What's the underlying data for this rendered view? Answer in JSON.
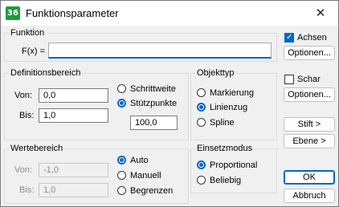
{
  "window": {
    "title": "Funktionsparameter",
    "app_icon": "36",
    "close_glyph": "✕"
  },
  "funktion": {
    "group_label": "Funktion",
    "fx_label": "F(x) =",
    "fx_value": ""
  },
  "definitionsbereich": {
    "group_label": "Definitionsbereich",
    "von_label": "Von:",
    "von_value": "0,0",
    "bis_label": "Bis:",
    "bis_value": "1,0",
    "schrittweite_label": "Schrittweite",
    "stuetzpunkte_label": "Stützpunkte",
    "stuetzpunkte_value": "100,0"
  },
  "objekttyp": {
    "group_label": "Objekttyp",
    "options": [
      "Markierung",
      "Linienzug",
      "Spline"
    ],
    "selected": "Linienzug"
  },
  "wertebereich": {
    "group_label": "Wertebereich",
    "von_label": "Von:",
    "von_value": "-1,0",
    "bis_label": "Bis:",
    "bis_value": "1,0",
    "options": [
      "Auto",
      "Manuell",
      "Begrenzen"
    ],
    "selected": "Auto"
  },
  "einsetzmodus": {
    "group_label": "Einsetzmodus",
    "options": [
      "Proportional",
      "Beliebig"
    ],
    "selected": "Proportional"
  },
  "right": {
    "achsen_label": "Achsen",
    "achsen_checked": true,
    "optionen1": "Optionen...",
    "schar_label": "Schar",
    "schar_checked": false,
    "optionen2": "Optionen...",
    "stift": "Stift >",
    "ebene": "Ebene >",
    "ok": "OK",
    "abbruch": "Abbruch"
  },
  "colors": {
    "accent": "#0067c0",
    "icon_bg": "#1e9b3c"
  }
}
